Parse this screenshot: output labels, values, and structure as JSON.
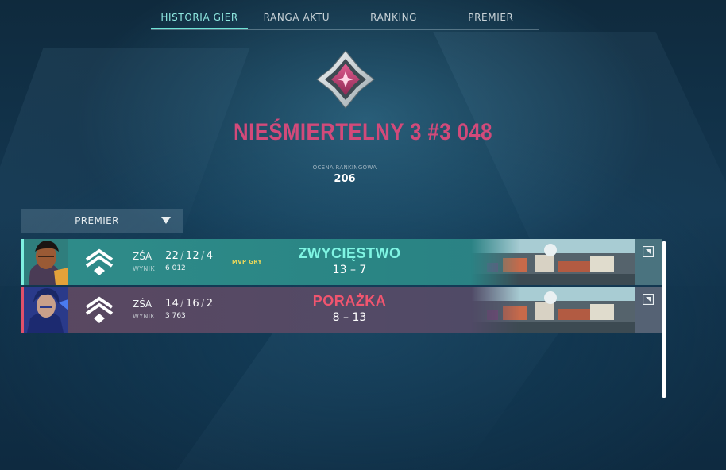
{
  "nav": {
    "tabs": [
      {
        "label": "HISTORIA GIER",
        "active": true
      },
      {
        "label": "RANGA AKTU",
        "active": false
      },
      {
        "label": "RANKING",
        "active": false
      },
      {
        "label": "PREMIER",
        "active": false
      }
    ]
  },
  "rank": {
    "title": "NIEŚMIERTELNY 3 #3 048",
    "rating_label": "OCENA RANKINGOWA",
    "rating_value": "206",
    "icon": "immortal-rank-icon",
    "title_color": "#d24a7a"
  },
  "filter": {
    "selected": "PREMIER",
    "icon": "triangle-down-icon"
  },
  "matches": [
    {
      "outcome": "win",
      "mode": "ZŚA",
      "kills": "22",
      "deaths": "12",
      "assists": "4",
      "score_label": "WYNIK",
      "score": "6 012",
      "mvp_label": "MVP GRY",
      "result": "ZWYCIĘSTWO",
      "rounds_won": "13",
      "rounds_sep": "–",
      "rounds_lost": "7",
      "accent": "#7ef0e0"
    },
    {
      "outcome": "loss",
      "mode": "ZŚA",
      "kills": "14",
      "deaths": "16",
      "assists": "2",
      "score_label": "WYNIK",
      "score": "3 763",
      "mvp_label": "",
      "result": "PORAŻKA",
      "rounds_won": "8",
      "rounds_sep": "–",
      "rounds_lost": "13",
      "accent": "#e0506a"
    }
  ]
}
